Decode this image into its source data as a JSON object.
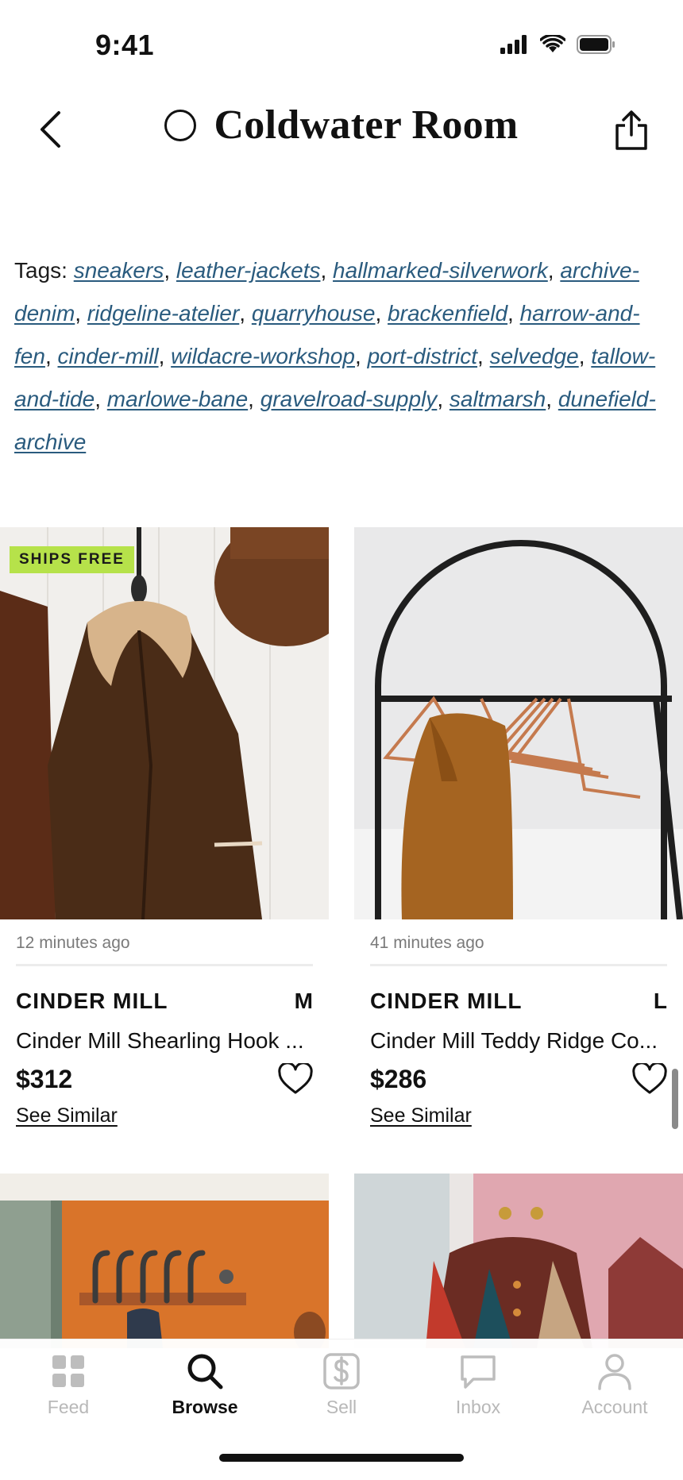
{
  "status_bar": {
    "time": "9:41"
  },
  "header": {
    "title": "Coldwater Room"
  },
  "tags": {
    "prefix": "Tags:",
    "items": [
      "sneakers",
      "leather-jackets",
      "hallmarked-silverwork",
      "archive-denim",
      "ridgeline-atelier",
      "quarryhouse",
      "brackenfield",
      "harrow-and-fen",
      "cinder-mill",
      "wildacre-workshop",
      "port-district",
      "selvedge",
      "tallow-and-tide",
      "marlowe-bane",
      "gravelroad-supply",
      "saltmarsh",
      "dunefield-archive"
    ]
  },
  "products": [
    {
      "badge": "SHIPS FREE",
      "time": "12 minutes ago",
      "brand": "CINDER MILL",
      "size": "M",
      "name": "Cinder Mill Shearling Hook ...",
      "price": "$312",
      "see_similar": "See Similar"
    },
    {
      "badge": "",
      "time": "41 minutes ago",
      "brand": "CINDER MILL",
      "size": "L",
      "name": "Cinder Mill Teddy Ridge Co...",
      "price": "$286",
      "see_similar": "See Similar"
    }
  ],
  "tab_bar": {
    "tabs": [
      {
        "label": "Feed",
        "icon": "grid-icon",
        "active": false
      },
      {
        "label": "Browse",
        "icon": "search-icon",
        "active": true
      },
      {
        "label": "Sell",
        "icon": "dollar-icon",
        "active": false
      },
      {
        "label": "Inbox",
        "icon": "chat-icon",
        "active": false
      },
      {
        "label": "Account",
        "icon": "person-icon",
        "active": false
      }
    ]
  },
  "colors": {
    "link": "#2a5b7e",
    "badge": "#b6e24a",
    "tab_inactive": "#b8b8b8"
  }
}
